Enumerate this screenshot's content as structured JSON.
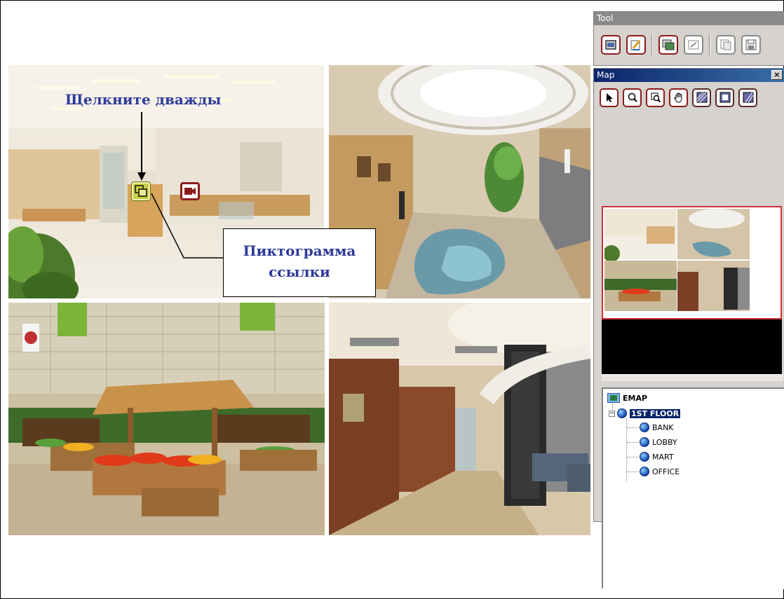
{
  "annotations": {
    "double_click": "Щелкните дважды",
    "link_icon_line1": "Пиктограмма",
    "link_icon_line2": "ссылки"
  },
  "tool_panel": {
    "title": "Tool",
    "buttons": [
      "open-map-icon",
      "edit-icon",
      "link-map-icon",
      "edit-link-icon",
      "copy-icon",
      "save-icon"
    ]
  },
  "map_panel": {
    "title": "Map",
    "close_label": "×",
    "tools": [
      "pointer-icon",
      "zoom-icon",
      "zoom-area-icon",
      "pan-hand-icon",
      "hatch-icon-1",
      "hatch-icon-2",
      "hatch-icon-3"
    ]
  },
  "tree": {
    "root": "EMAP",
    "floor": "1ST FLOOR",
    "expander": "−",
    "children": [
      "BANK",
      "LOBBY",
      "MART",
      "OFFICE"
    ]
  },
  "colors": {
    "annotation_text": "#2e3b9a",
    "icon_border": "#8b1c1c",
    "selection": "#0a246a",
    "preview_border": "#d0303a"
  }
}
